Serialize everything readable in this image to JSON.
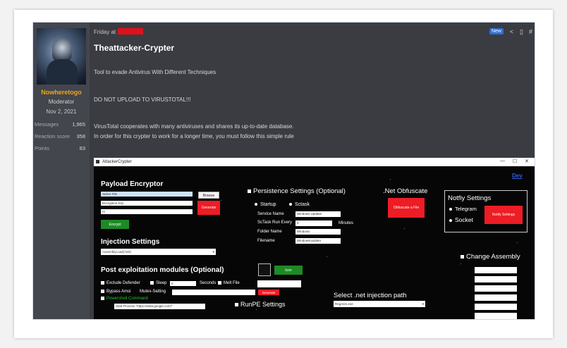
{
  "forum": {
    "user": {
      "name": "Nowheretogo",
      "role": "Moderator",
      "joined": "Nov 2, 2021",
      "stats": [
        {
          "label": "Messages",
          "value": "1,965"
        },
        {
          "label": "Reaction score",
          "value": "358"
        },
        {
          "label": "Points",
          "value": "83"
        }
      ]
    },
    "post": {
      "date": "Friday at",
      "badge": "New",
      "title": "Theattacker-Crypter",
      "lines": [
        "Tool to evade Antivirus With Different Techniques",
        "DO NOT UPLOAD TO VIRUSTOTAL!!!",
        "VirusTotal cooperates with many antiviruses and shares its up-to-date database.",
        "In order for this crypter to work for a longer time, you must follow this simple rule"
      ]
    }
  },
  "app": {
    "window_title": "AttackerCrypter",
    "window_buttons": [
      "—",
      "☐",
      "✕"
    ],
    "dev_link": "Dev",
    "payload": {
      "heading": "Payload Encryptor",
      "file_field": "Select File",
      "key_field": "Encryption Key",
      "iv_field": "IV",
      "browse": "Browse",
      "generate": "Generate",
      "encrypt": "Encrypt"
    },
    "injection": {
      "heading": "Injection Settings",
      "selected": "AssemblyLoad(.Net)"
    },
    "post_exploit": {
      "heading": "Post exploitation modules (Optional)",
      "exclude": "Exclude Defender",
      "sleep": "Sleep",
      "sleep_value": "0",
      "seconds": "Seconds",
      "melt": "Melt File",
      "bypass": "Bypass Amsi",
      "mutex": "Mutex-Setting",
      "mutex_generate": "Generate",
      "powershell": "Powershell Command",
      "powershell_value": "Start-Process \"https://www.google.com/\"",
      "icon_btn": "Icon"
    },
    "persistence": {
      "heading": "Persistence Settings (Optional)",
      "startup": "Startup",
      "sctask": "Sctask",
      "service_name_label": "Service Name",
      "service_name_value": "Windows Updater",
      "run_every_label": "ScTask Run Every",
      "run_every_value": "0",
      "minutes": "Minutes",
      "folder_label": "Folder Name",
      "folder_value": "Windows",
      "filename_label": "Filename",
      "filename_value": "WindowsUpdater"
    },
    "runpe": "RunPE Settings",
    "net_path": {
      "heading": "Select .net injection path",
      "selected": "RegAsm.exe"
    },
    "obfuscate": {
      "heading": ".Net Obfuscate",
      "button": "Obfuscate a File"
    },
    "notify": {
      "heading": "Notfiy Settings",
      "telegram": "Telegram",
      "socket": "Socket",
      "button": "Notify Settings"
    },
    "assembly": "Change Assembly"
  },
  "colors": {
    "username": "#f2a41c",
    "red_button": "#ee1c24",
    "green_button": "#1e8a24",
    "new_badge": "#2d6fd3"
  }
}
